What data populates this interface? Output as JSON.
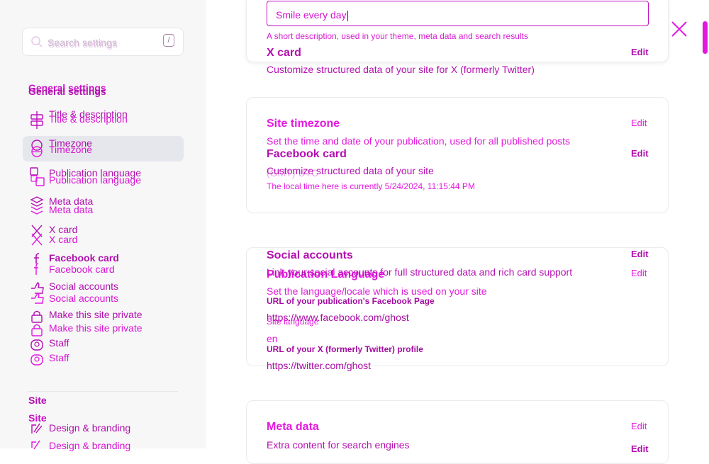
{
  "search": {
    "placeholder": "Search settings",
    "shortcut": "/"
  },
  "general": {
    "title": "General settings",
    "items": [
      {
        "label": "Title & description",
        "icon": "title-description-icon"
      },
      {
        "label": "Timezone",
        "icon": "globe-icon"
      },
      {
        "label": "Publication language",
        "icon": "language-icon"
      },
      {
        "label": "Meta data",
        "icon": "layers-icon"
      },
      {
        "label": "X card",
        "icon": "x-icon"
      },
      {
        "label": "Facebook card",
        "icon": "facebook-icon"
      },
      {
        "label": "Social accounts",
        "icon": "thumbs-up-icon"
      },
      {
        "label": "Make this site private",
        "icon": "lock-icon"
      },
      {
        "label": "Staff",
        "icon": "staff-icon"
      }
    ]
  },
  "site": {
    "title": "Site",
    "items": [
      {
        "label": "Design & branding",
        "icon": "brush-icon"
      }
    ]
  },
  "description_field": {
    "value": "Smile every day",
    "hint": "A short description, used in your theme, meta data and search results"
  },
  "x_card": {
    "title": "X card",
    "subtitle": "Customize structured data of your site for X (formerly Twitter)",
    "edit": "Edit"
  },
  "timezone": {
    "title": "Site timezone",
    "subtitle": "Set the time and date of your publication, used for all published posts",
    "edit": "Edit",
    "value": "(GMT) UTC",
    "note": "The local time here is currently 5/24/2024, 11:15:44 PM"
  },
  "facebook_card": {
    "title": "Facebook card",
    "subtitle": "Customize structured data of your site",
    "edit": "Edit"
  },
  "social": {
    "title": "Social accounts",
    "subtitle": "Link your social accounts for full structured data and rich card support",
    "edit": "Edit",
    "facebook_label": "URL of your publication's Facebook Page",
    "facebook_value": "https://www.facebook.com/ghost",
    "x_label": "URL of your X (formerly Twitter) profile",
    "x_value": "https://twitter.com/ghost"
  },
  "language": {
    "title": "Publication Language",
    "subtitle": "Set the language/locale which is used on your site",
    "edit": "Edit",
    "label": "Site language",
    "value": "en"
  },
  "meta": {
    "title": "Meta data",
    "subtitle": "Extra content for search engines",
    "edit": "Edit"
  },
  "colors": {
    "accent": "#e418e0",
    "accent_dark": "#b30fb0",
    "sidebar_bg": "#f7f7f8",
    "active_bg": "#e6e7ec"
  }
}
